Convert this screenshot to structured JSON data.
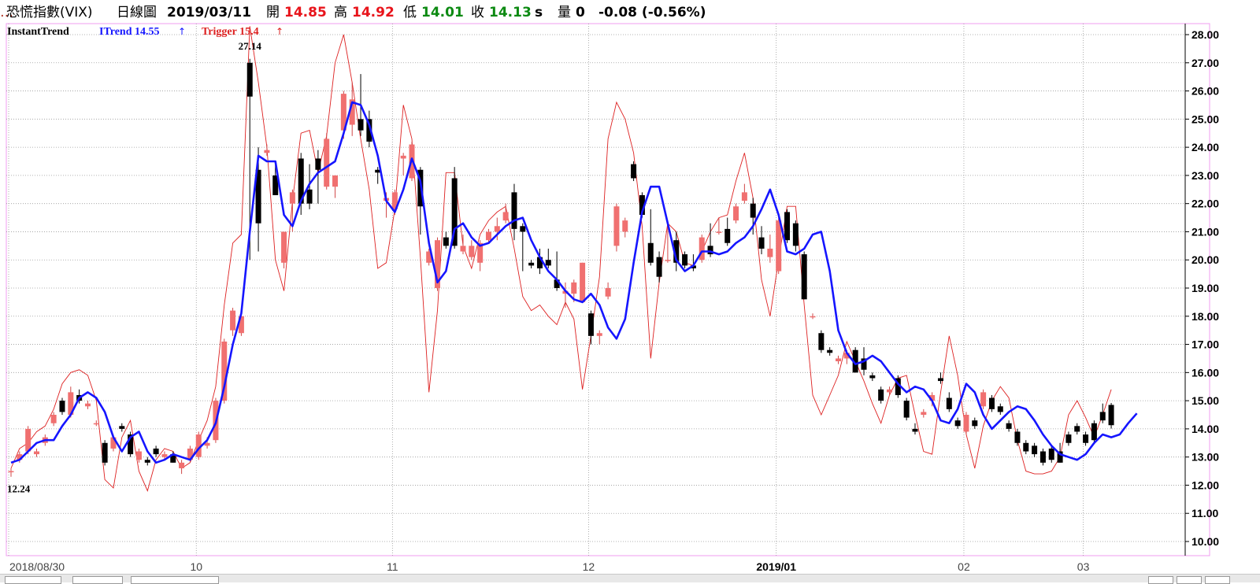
{
  "header": {
    "symbol": "恐慌指數(VIX)",
    "chart_kind": "日線圖",
    "date": "2019/03/11",
    "open_label": "開",
    "open": "14.85",
    "high_label": "高",
    "high": "14.92",
    "low_label": "低",
    "low": "14.01",
    "close_label": "收",
    "close": "14.13",
    "close_suffix": "s",
    "volume_label": "量",
    "volume": "0",
    "change": "-0.08 (-0.56%)"
  },
  "legend": {
    "indicator": "InstantTrend",
    "itrend": "ITrend 14.55",
    "trigger": "Trigger 15.4"
  },
  "annotations": {
    "high_label": "27.14",
    "low_label": "12.24"
  },
  "colors": {
    "up_candle": "#f07070",
    "down_candle": "#000000",
    "itrend_line": "#1515ff",
    "trigger_line": "#dd2020",
    "grid": "#9a9a9a",
    "frame": "#f09cf0"
  },
  "chart_data": {
    "type": "candlestick",
    "x_tick_labels": [
      "2018/08/30",
      "10",
      "11",
      "12",
      "2019/01",
      "02",
      "03"
    ],
    "y_tick_labels": [
      "28.00",
      "27.00",
      "26.00",
      "25.00",
      "24.00",
      "23.00",
      "22.00",
      "21.00",
      "20.00",
      "19.00",
      "18.00",
      "17.00",
      "16.00",
      "15.00",
      "14.00",
      "13.00",
      "12.00",
      "11.00",
      "10.00"
    ],
    "ylim": [
      10,
      28
    ],
    "x_ticks_index": [
      0,
      22,
      45,
      68,
      90,
      112,
      126
    ],
    "candles": [
      [
        12.5,
        12.6,
        12.3,
        12.5
      ],
      [
        12.9,
        13.2,
        12.8,
        13.1
      ],
      [
        13.2,
        14.1,
        13.1,
        14.0
      ],
      [
        13.1,
        13.3,
        13.0,
        13.2
      ],
      [
        13.5,
        13.8,
        13.4,
        13.7
      ],
      [
        14.2,
        14.6,
        14.1,
        14.5
      ],
      [
        15.0,
        15.1,
        14.5,
        14.6
      ],
      [
        14.5,
        15.5,
        14.4,
        15.3
      ],
      [
        15.2,
        15.4,
        14.9,
        15.0
      ],
      [
        14.8,
        15.0,
        14.7,
        14.9
      ],
      [
        14.2,
        14.3,
        14.1,
        14.2
      ],
      [
        13.5,
        13.6,
        12.7,
        12.8
      ],
      [
        13.3,
        13.8,
        13.2,
        13.7
      ],
      [
        14.1,
        14.2,
        13.9,
        14.0
      ],
      [
        13.8,
        13.9,
        13.0,
        13.1
      ],
      [
        12.9,
        13.3,
        12.8,
        13.2
      ],
      [
        12.9,
        13.0,
        12.7,
        12.8
      ],
      [
        13.3,
        13.4,
        13.0,
        13.1
      ],
      [
        13.0,
        13.2,
        12.9,
        13.1
      ],
      [
        13.1,
        13.2,
        12.8,
        12.8
      ],
      [
        12.6,
        12.9,
        12.4,
        12.8
      ],
      [
        12.9,
        13.4,
        12.8,
        13.3
      ],
      [
        13.0,
        13.9,
        12.9,
        13.8
      ],
      [
        13.4,
        13.7,
        13.3,
        13.5
      ],
      [
        13.6,
        15.1,
        13.5,
        15.0
      ],
      [
        15.0,
        17.2,
        14.9,
        17.1
      ],
      [
        17.5,
        18.3,
        17.3,
        18.2
      ],
      [
        17.4,
        18.2,
        17.3,
        18.0
      ],
      [
        27.0,
        27.14,
        20.0,
        25.8
      ],
      [
        23.2,
        24.0,
        20.3,
        21.3
      ],
      [
        23.8,
        24.1,
        23.7,
        23.9
      ],
      [
        23.0,
        23.5,
        22.3,
        22.3
      ],
      [
        19.9,
        21.0,
        19.7,
        21.0
      ],
      [
        22.0,
        22.5,
        21.0,
        22.4
      ],
      [
        23.6,
        23.8,
        21.6,
        22.0
      ],
      [
        22.5,
        23.4,
        21.8,
        22.0
      ],
      [
        23.6,
        23.9,
        22.0,
        23.2
      ],
      [
        22.6,
        24.5,
        22.5,
        24.3
      ],
      [
        22.6,
        23.0,
        22.2,
        23.0
      ],
      [
        24.6,
        26.0,
        24.3,
        25.9
      ],
      [
        24.8,
        26.3,
        24.4,
        25.7
      ],
      [
        25.0,
        26.6,
        24.4,
        24.6
      ],
      [
        25.0,
        25.3,
        24.0,
        24.2
      ],
      [
        23.2,
        23.3,
        22.7,
        23.1
      ],
      [
        22.1,
        22.4,
        21.5,
        22.2
      ],
      [
        21.8,
        22.5,
        21.6,
        22.4
      ],
      [
        23.6,
        23.8,
        23.0,
        23.7
      ],
      [
        22.9,
        24.2,
        22.8,
        24.1
      ],
      [
        23.2,
        23.3,
        20.9,
        21.9
      ],
      [
        19.9,
        20.4,
        19.8,
        20.3
      ],
      [
        19.0,
        20.8,
        18.9,
        20.7
      ],
      [
        20.8,
        21.0,
        20.4,
        20.5
      ],
      [
        22.9,
        23.3,
        20.4,
        20.5
      ],
      [
        20.3,
        20.9,
        20.2,
        20.5
      ],
      [
        20.1,
        20.7,
        20.0,
        20.5
      ],
      [
        19.9,
        20.7,
        19.6,
        20.6
      ],
      [
        20.7,
        21.1,
        20.6,
        21.0
      ],
      [
        21.0,
        21.5,
        20.7,
        21.2
      ],
      [
        21.4,
        22.0,
        21.3,
        21.7
      ],
      [
        22.4,
        22.7,
        20.7,
        21.1
      ],
      [
        21.2,
        21.3,
        19.6,
        21.0
      ],
      [
        19.9,
        20.0,
        19.7,
        19.8
      ],
      [
        20.1,
        20.4,
        19.5,
        19.7
      ],
      [
        20.0,
        20.4,
        19.7,
        19.8
      ],
      [
        19.3,
        20.3,
        18.9,
        19.0
      ],
      [
        18.8,
        19.2,
        18.3,
        18.9
      ],
      [
        18.8,
        19.3,
        18.5,
        19.2
      ],
      [
        18.5,
        19.9,
        18.5,
        19.9
      ],
      [
        18.1,
        18.2,
        17.0,
        17.3
      ],
      [
        17.3,
        17.5,
        17.0,
        17.4
      ],
      [
        18.7,
        19.2,
        18.6,
        19.0
      ],
      [
        20.5,
        22.0,
        20.3,
        21.9
      ],
      [
        21.0,
        21.5,
        20.8,
        21.4
      ],
      [
        23.4,
        23.5,
        22.8,
        22.9
      ],
      [
        22.3,
        22.4,
        21.5,
        21.6
      ],
      [
        20.6,
        21.8,
        19.8,
        19.9
      ],
      [
        20.1,
        20.3,
        19.2,
        19.4
      ],
      [
        20.0,
        21.3,
        19.9,
        20.0
      ],
      [
        20.7,
        21.0,
        19.6,
        19.9
      ],
      [
        20.2,
        20.3,
        19.7,
        19.8
      ],
      [
        19.8,
        20.2,
        19.6,
        19.7
      ],
      [
        20.0,
        20.9,
        19.9,
        20.8
      ],
      [
        20.5,
        21.3,
        20.1,
        20.2
      ],
      [
        21.0,
        21.5,
        20.9,
        21.0
      ],
      [
        21.1,
        21.5,
        20.5,
        20.6
      ],
      [
        21.4,
        22.0,
        21.3,
        21.9
      ],
      [
        22.1,
        22.7,
        22.0,
        22.4
      ],
      [
        22.0,
        22.2,
        20.9,
        21.5
      ],
      [
        20.8,
        21.2,
        20.2,
        20.4
      ],
      [
        20.1,
        20.9,
        19.9,
        20.4
      ],
      [
        19.6,
        21.5,
        19.5,
        21.4
      ],
      [
        21.7,
        21.8,
        20.6,
        20.7
      ],
      [
        21.3,
        21.4,
        20.3,
        20.5
      ],
      [
        20.2,
        20.3,
        18.6,
        18.6
      ],
      [
        18.0,
        18.1,
        17.9,
        18.0
      ],
      [
        17.4,
        17.5,
        16.7,
        16.8
      ],
      [
        16.8,
        16.9,
        16.6,
        16.7
      ],
      [
        16.4,
        16.6,
        16.3,
        16.5
      ],
      [
        16.5,
        16.8,
        16.3,
        16.7
      ],
      [
        16.8,
        16.9,
        16.0,
        16.0
      ],
      [
        16.5,
        16.9,
        15.9,
        16.1
      ],
      [
        15.9,
        16.0,
        15.7,
        15.8
      ],
      [
        15.4,
        15.5,
        14.9,
        15.0
      ],
      [
        15.3,
        15.5,
        15.2,
        15.4
      ],
      [
        15.8,
        15.9,
        15.1,
        15.2
      ],
      [
        15.0,
        15.1,
        14.3,
        14.4
      ],
      [
        14.0,
        14.2,
        13.8,
        13.9
      ],
      [
        14.5,
        14.7,
        14.4,
        14.6
      ],
      [
        15.0,
        15.3,
        14.8,
        15.2
      ],
      [
        15.8,
        16.0,
        15.6,
        15.7
      ],
      [
        15.1,
        15.3,
        14.6,
        14.7
      ],
      [
        14.3,
        14.4,
        14.0,
        14.1
      ],
      [
        13.9,
        14.6,
        13.8,
        14.5
      ],
      [
        14.3,
        14.4,
        14.0,
        14.1
      ],
      [
        14.8,
        15.4,
        14.7,
        15.3
      ],
      [
        15.1,
        15.2,
        14.6,
        14.7
      ],
      [
        14.8,
        14.9,
        14.5,
        14.6
      ],
      [
        14.2,
        14.3,
        13.9,
        14.0
      ],
      [
        13.9,
        14.0,
        13.4,
        13.5
      ],
      [
        13.5,
        13.6,
        13.1,
        13.2
      ],
      [
        13.4,
        13.5,
        13.0,
        13.1
      ],
      [
        13.2,
        13.3,
        12.7,
        12.8
      ],
      [
        13.3,
        13.4,
        12.8,
        12.9
      ],
      [
        13.2,
        13.5,
        12.8,
        12.8
      ],
      [
        13.8,
        13.9,
        13.4,
        13.5
      ],
      [
        14.1,
        14.2,
        13.8,
        13.9
      ],
      [
        13.8,
        13.9,
        13.4,
        13.5
      ],
      [
        14.2,
        14.3,
        13.5,
        13.6
      ],
      [
        14.6,
        14.9,
        14.2,
        14.3
      ],
      [
        14.85,
        14.92,
        14.01,
        14.13
      ]
    ],
    "series": [
      {
        "name": "ITrend",
        "values": [
          12.8,
          12.9,
          13.2,
          13.5,
          13.6,
          13.6,
          14.1,
          14.5,
          15.1,
          15.3,
          15.1,
          14.6,
          13.7,
          13.2,
          13.7,
          13.9,
          13.2,
          12.8,
          12.9,
          13.1,
          13.0,
          12.9,
          13.3,
          13.6,
          14.2,
          15.5,
          17.0,
          18.1,
          21.0,
          23.7,
          23.5,
          23.5,
          21.6,
          21.2,
          22.1,
          22.7,
          23.1,
          23.3,
          23.5,
          24.5,
          25.6,
          25.5,
          24.8,
          23.7,
          22.1,
          21.7,
          22.5,
          23.6,
          22.8,
          20.6,
          19.2,
          19.6,
          21.1,
          21.3,
          20.8,
          20.5,
          20.6,
          20.9,
          21.2,
          21.4,
          21.5,
          20.7,
          20.1,
          19.6,
          19.3,
          18.9,
          18.6,
          18.5,
          18.8,
          18.4,
          17.6,
          17.2,
          17.9,
          19.9,
          21.7,
          22.6,
          22.6,
          21.3,
          20.0,
          19.6,
          19.8,
          20.3,
          20.3,
          20.2,
          20.3,
          20.6,
          20.8,
          21.2,
          21.8,
          22.5,
          21.6,
          20.3,
          20.2,
          20.4,
          20.9,
          21.0,
          19.6,
          17.5,
          16.7,
          16.3,
          16.4,
          16.6,
          16.4,
          16.0,
          15.6,
          15.3,
          15.5,
          15.4,
          15.0,
          14.3,
          14.2,
          14.7,
          15.6,
          15.3,
          14.5,
          14.0,
          14.3,
          14.6,
          14.8,
          14.7,
          14.3,
          13.8,
          13.4,
          13.1,
          13.0,
          12.9,
          13.1,
          13.5,
          13.8,
          13.7,
          13.8,
          14.2,
          14.55
        ]
      },
      {
        "name": "Trigger",
        "values": [
          12.6,
          13.3,
          13.5,
          13.9,
          14.1,
          14.7,
          15.6,
          16.0,
          16.1,
          15.9,
          15.0,
          12.2,
          11.9,
          13.7,
          14.3,
          12.5,
          11.8,
          12.9,
          13.3,
          13.2,
          12.6,
          12.8,
          13.6,
          14.3,
          15.5,
          18.4,
          20.6,
          20.9,
          28.3,
          26.3,
          24.0,
          20.0,
          18.9,
          22.1,
          24.5,
          24.6,
          23.1,
          24.4,
          27.0,
          28.0,
          26.3,
          24.3,
          22.5,
          19.7,
          19.9,
          21.8,
          25.5,
          24.3,
          20.1,
          15.3,
          18.2,
          23.1,
          23.1,
          20.5,
          19.7,
          20.9,
          21.4,
          21.7,
          21.9,
          20.4,
          18.7,
          18.2,
          18.4,
          18.0,
          17.7,
          18.5,
          17.9,
          15.4,
          17.3,
          19.4,
          24.3,
          25.6,
          25.0,
          23.8,
          21.2,
          16.5,
          19.2,
          21.3,
          21.0,
          19.9,
          19.8,
          20.3,
          21.0,
          21.5,
          21.6,
          22.8,
          23.8,
          22.2,
          19.3,
          18.0,
          20.0,
          21.9,
          21.9,
          18.4,
          15.2,
          14.5,
          15.2,
          15.9,
          17.1,
          16.4,
          15.7,
          14.9,
          14.2,
          15.2,
          15.8,
          15.9,
          14.5,
          13.2,
          13.1,
          15.3,
          17.3,
          15.9,
          13.8,
          12.6,
          14.1,
          15.0,
          15.5,
          15.1,
          13.6,
          12.5,
          12.4,
          12.4,
          12.5,
          13.0,
          14.5,
          15.0,
          14.4,
          13.7,
          14.5,
          15.4
        ]
      }
    ]
  }
}
